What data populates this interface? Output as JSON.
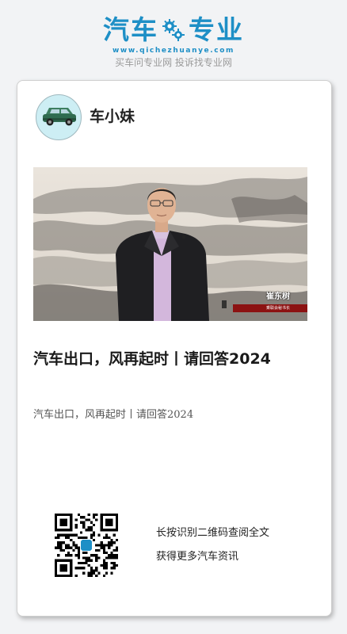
{
  "brand": {
    "name_part1": "汽车",
    "name_part2": "专业",
    "url": "www.qichezhuanye.com",
    "tagline": "买车问专业网 投诉找专业网"
  },
  "author": {
    "name": "车小妹"
  },
  "video": {
    "person_name": "崔东树",
    "person_title": "乘联会秘书长"
  },
  "article": {
    "title": "汽车出口，风再起时丨请回答2024",
    "summary": "汽车出口，风再起时丨请回答2024"
  },
  "qr": {
    "line1": "长按识别二维码查阅全文",
    "line2": "获得更多汽车资讯"
  },
  "colors": {
    "brand": "#1e8fc6",
    "background": "#f2f3f5",
    "card": "#ffffff",
    "name_bar": "#8c1212"
  }
}
